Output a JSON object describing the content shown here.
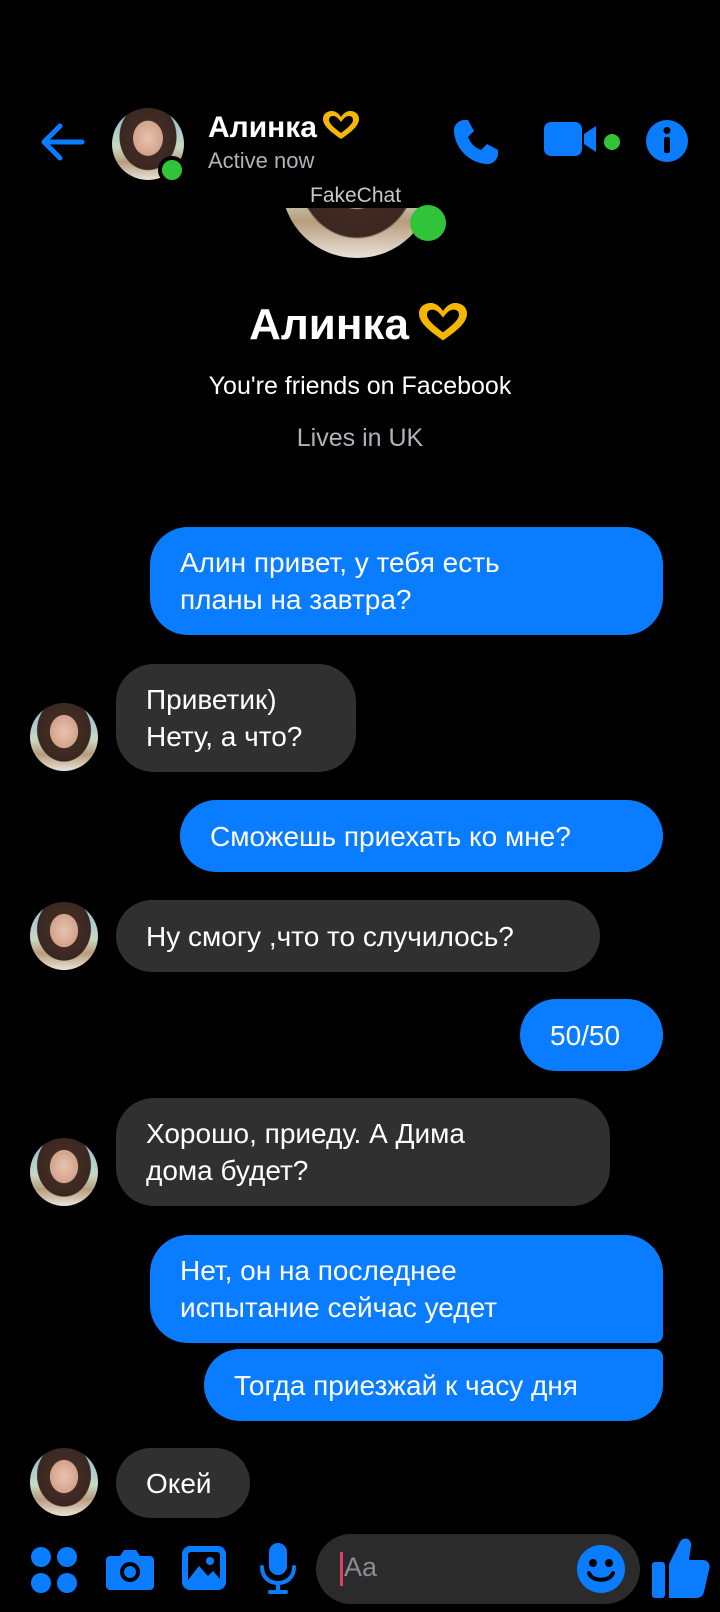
{
  "header": {
    "contact_name": "Алинка",
    "status": "Active now",
    "watermark": "FakeChat"
  },
  "profile": {
    "name": "Алинка",
    "friendship": "You're friends on Facebook",
    "location": "Lives in UK"
  },
  "messages": [
    {
      "direction": "out",
      "text": "Алин привет, у тебя есть\nпланы на завтра?"
    },
    {
      "direction": "in",
      "text": "Приветик)\nНету, а что?"
    },
    {
      "direction": "out",
      "text": "Сможешь приехать ко мне?"
    },
    {
      "direction": "in",
      "text": "Ну смогу ,что то случилось?"
    },
    {
      "direction": "out",
      "text": "50/50"
    },
    {
      "direction": "in",
      "text": "Хорошо, приеду. А Дима\nдома будет?"
    },
    {
      "direction": "out",
      "text": "Нет, он на последнее\nиспытание сейчас уедет"
    },
    {
      "direction": "out",
      "text": "Тогда приезжай к часу дня"
    },
    {
      "direction": "in",
      "text": "Окей"
    }
  ],
  "composer": {
    "placeholder": "Aa"
  },
  "colors": {
    "accent": "#0a7cff",
    "incoming_bubble": "#303030",
    "online": "#31c43a",
    "heart": "#f5b700"
  },
  "icons": [
    "back-arrow-icon",
    "phone-icon",
    "video-camera-icon",
    "info-icon",
    "apps-icon",
    "camera-icon",
    "gallery-icon",
    "microphone-icon",
    "emoji-icon",
    "thumbs-up-icon"
  ]
}
